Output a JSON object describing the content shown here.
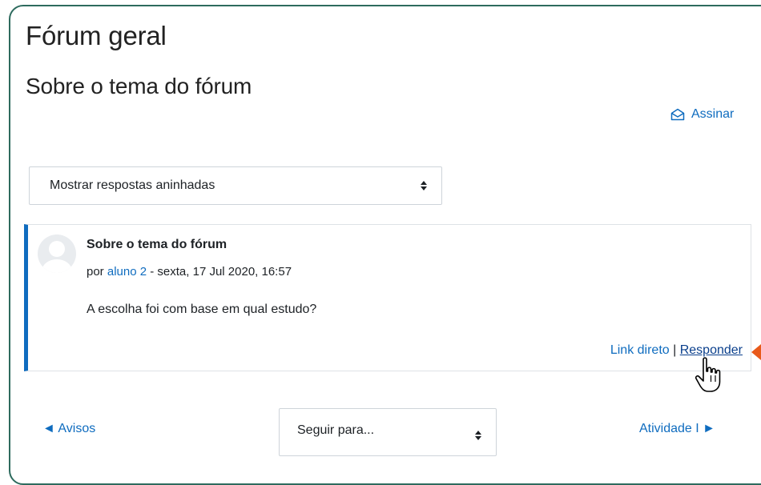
{
  "forum": {
    "title": "Fórum geral",
    "discussion_title": "Sobre o tema do fórum"
  },
  "subscribe": {
    "label": "Assinar",
    "icon": "envelope-open-icon"
  },
  "display_mode": {
    "selected": "Mostrar respostas aninhadas"
  },
  "post": {
    "subject": "Sobre o tema do fórum",
    "by_prefix": "por ",
    "author": "aluno 2",
    "date": " - sexta, 17 Jul 2020, 16:57",
    "message": "A escolha foi com base em qual estudo?",
    "permalink_label": "Link direto",
    "separator": " | ",
    "reply_label": "Responder"
  },
  "navigation": {
    "prev_label": "◄ Avisos",
    "jump_placeholder": "Seguir para...",
    "next_label": "Atividade I ►"
  },
  "colors": {
    "accent": "#0f6cbf",
    "frame": "#2e6b5e",
    "pointer": "#e8591a"
  }
}
